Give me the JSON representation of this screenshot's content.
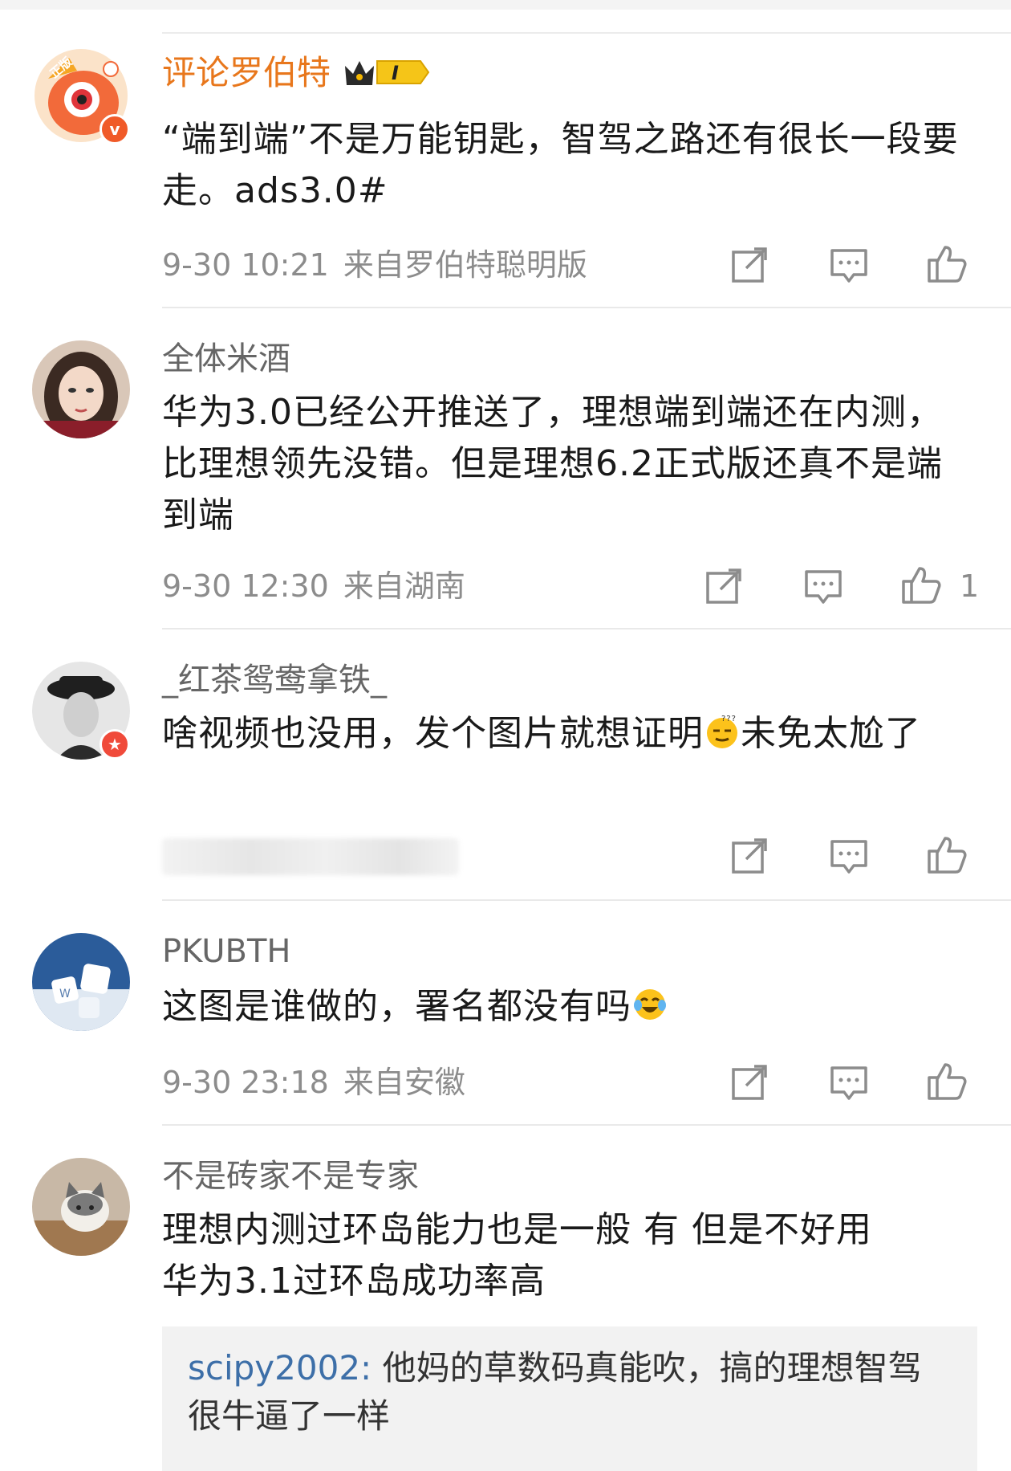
{
  "comments": [
    {
      "username": "评论罗伯特",
      "badge_level": "I",
      "text": "“端到端”不是万能钥匙，智驾之路还有很长一段要走。ads3.0#",
      "time": "9-30 10:21",
      "source": "来自罗伯特聪明版",
      "avatar_tag": "正版"
    },
    {
      "username": "全体米酒",
      "text": "华为3.0已经公开推送了，理想端到端还在内测，比理想领先没错。但是理想6.2正式版还真不是端到端",
      "time": "9-30 12:30",
      "source": "来自湖南",
      "likes": "1"
    },
    {
      "username": "_红茶鸳鸯拿铁_",
      "text_before_emoji": "啥视频也没用，发个图片就想证明",
      "text_after_emoji": "未免太尬了"
    },
    {
      "username": "PKUBTH",
      "text": "这图是谁做的，署名都没有吗",
      "time": "9-30 23:18",
      "source": "来自安徽"
    },
    {
      "username": "不是砖家不是专家",
      "text_line1": "理想内测过环岛能力也是一般 有 但是不好用",
      "text_line2": "华为3.1过环岛成功率高",
      "reply": {
        "user": "scipy2002",
        "separator": ": ",
        "text": "他妈的草数码真能吹，搞的理想智驾很牛逼了一样"
      }
    }
  ],
  "icons": {
    "share": "share-icon",
    "comment": "comment-icon",
    "like": "like-icon"
  },
  "colors": {
    "vip_name": "#e8771c",
    "reply_user": "#3d6fa8",
    "meta": "#8c8c8c"
  }
}
